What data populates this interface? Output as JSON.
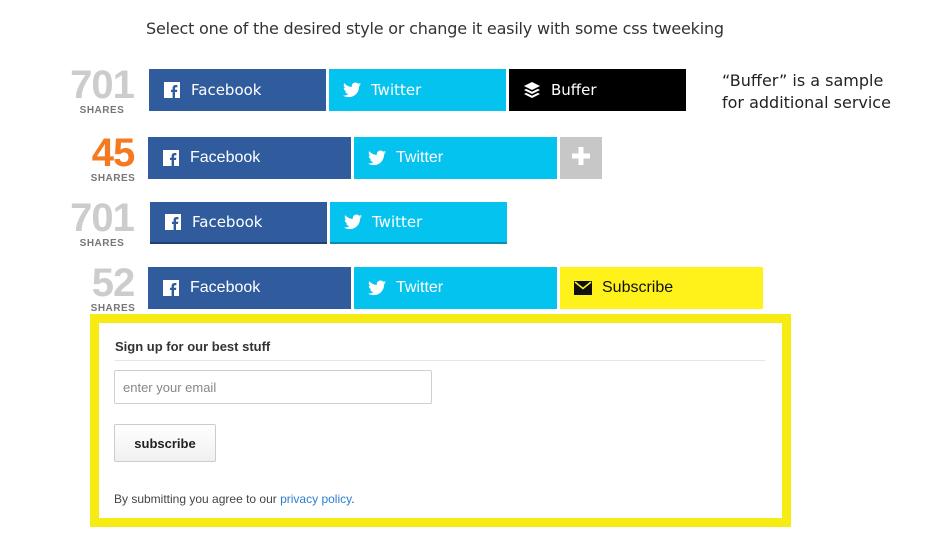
{
  "heading": "Select one of the desired style or change it easily with some css tweeking",
  "note": {
    "line1": "“Buffer” is a sample",
    "line2": "for additional service"
  },
  "colors": {
    "facebook": "#305c9d",
    "twitter": "#04c3ef",
    "buffer": "#000000",
    "subscribe": "#fff21b",
    "plus": "#c7c7c7",
    "count_gray": "#cccccc",
    "count_orange": "#f47920",
    "signup_border": "#f6ec13"
  },
  "rows": [
    {
      "count": "701",
      "count_label": "SHARES",
      "facebook": "Facebook",
      "twitter": "Twitter",
      "buffer": "Buffer"
    },
    {
      "count": "45",
      "count_label": "SHARES",
      "facebook": "Facebook",
      "twitter": "Twitter",
      "extra_icon": "plus-icon"
    },
    {
      "count": "701",
      "count_label": "SHARES",
      "facebook": "Facebook",
      "twitter": "Twitter"
    },
    {
      "count": "52",
      "count_label": "SHARES",
      "facebook": "Facebook",
      "twitter": "Twitter",
      "subscribe": "Subscribe"
    }
  ],
  "icons": {
    "facebook": "facebook-icon",
    "twitter": "twitter-icon",
    "buffer": "buffer-icon",
    "subscribe": "envelope-icon"
  },
  "signup": {
    "title": "Sign up for our best stuff",
    "email_placeholder": "enter your email",
    "email_value": "",
    "button": "subscribe",
    "legal_prefix": "By submitting you agree to our ",
    "legal_link": "privacy policy",
    "legal_suffix": "."
  }
}
